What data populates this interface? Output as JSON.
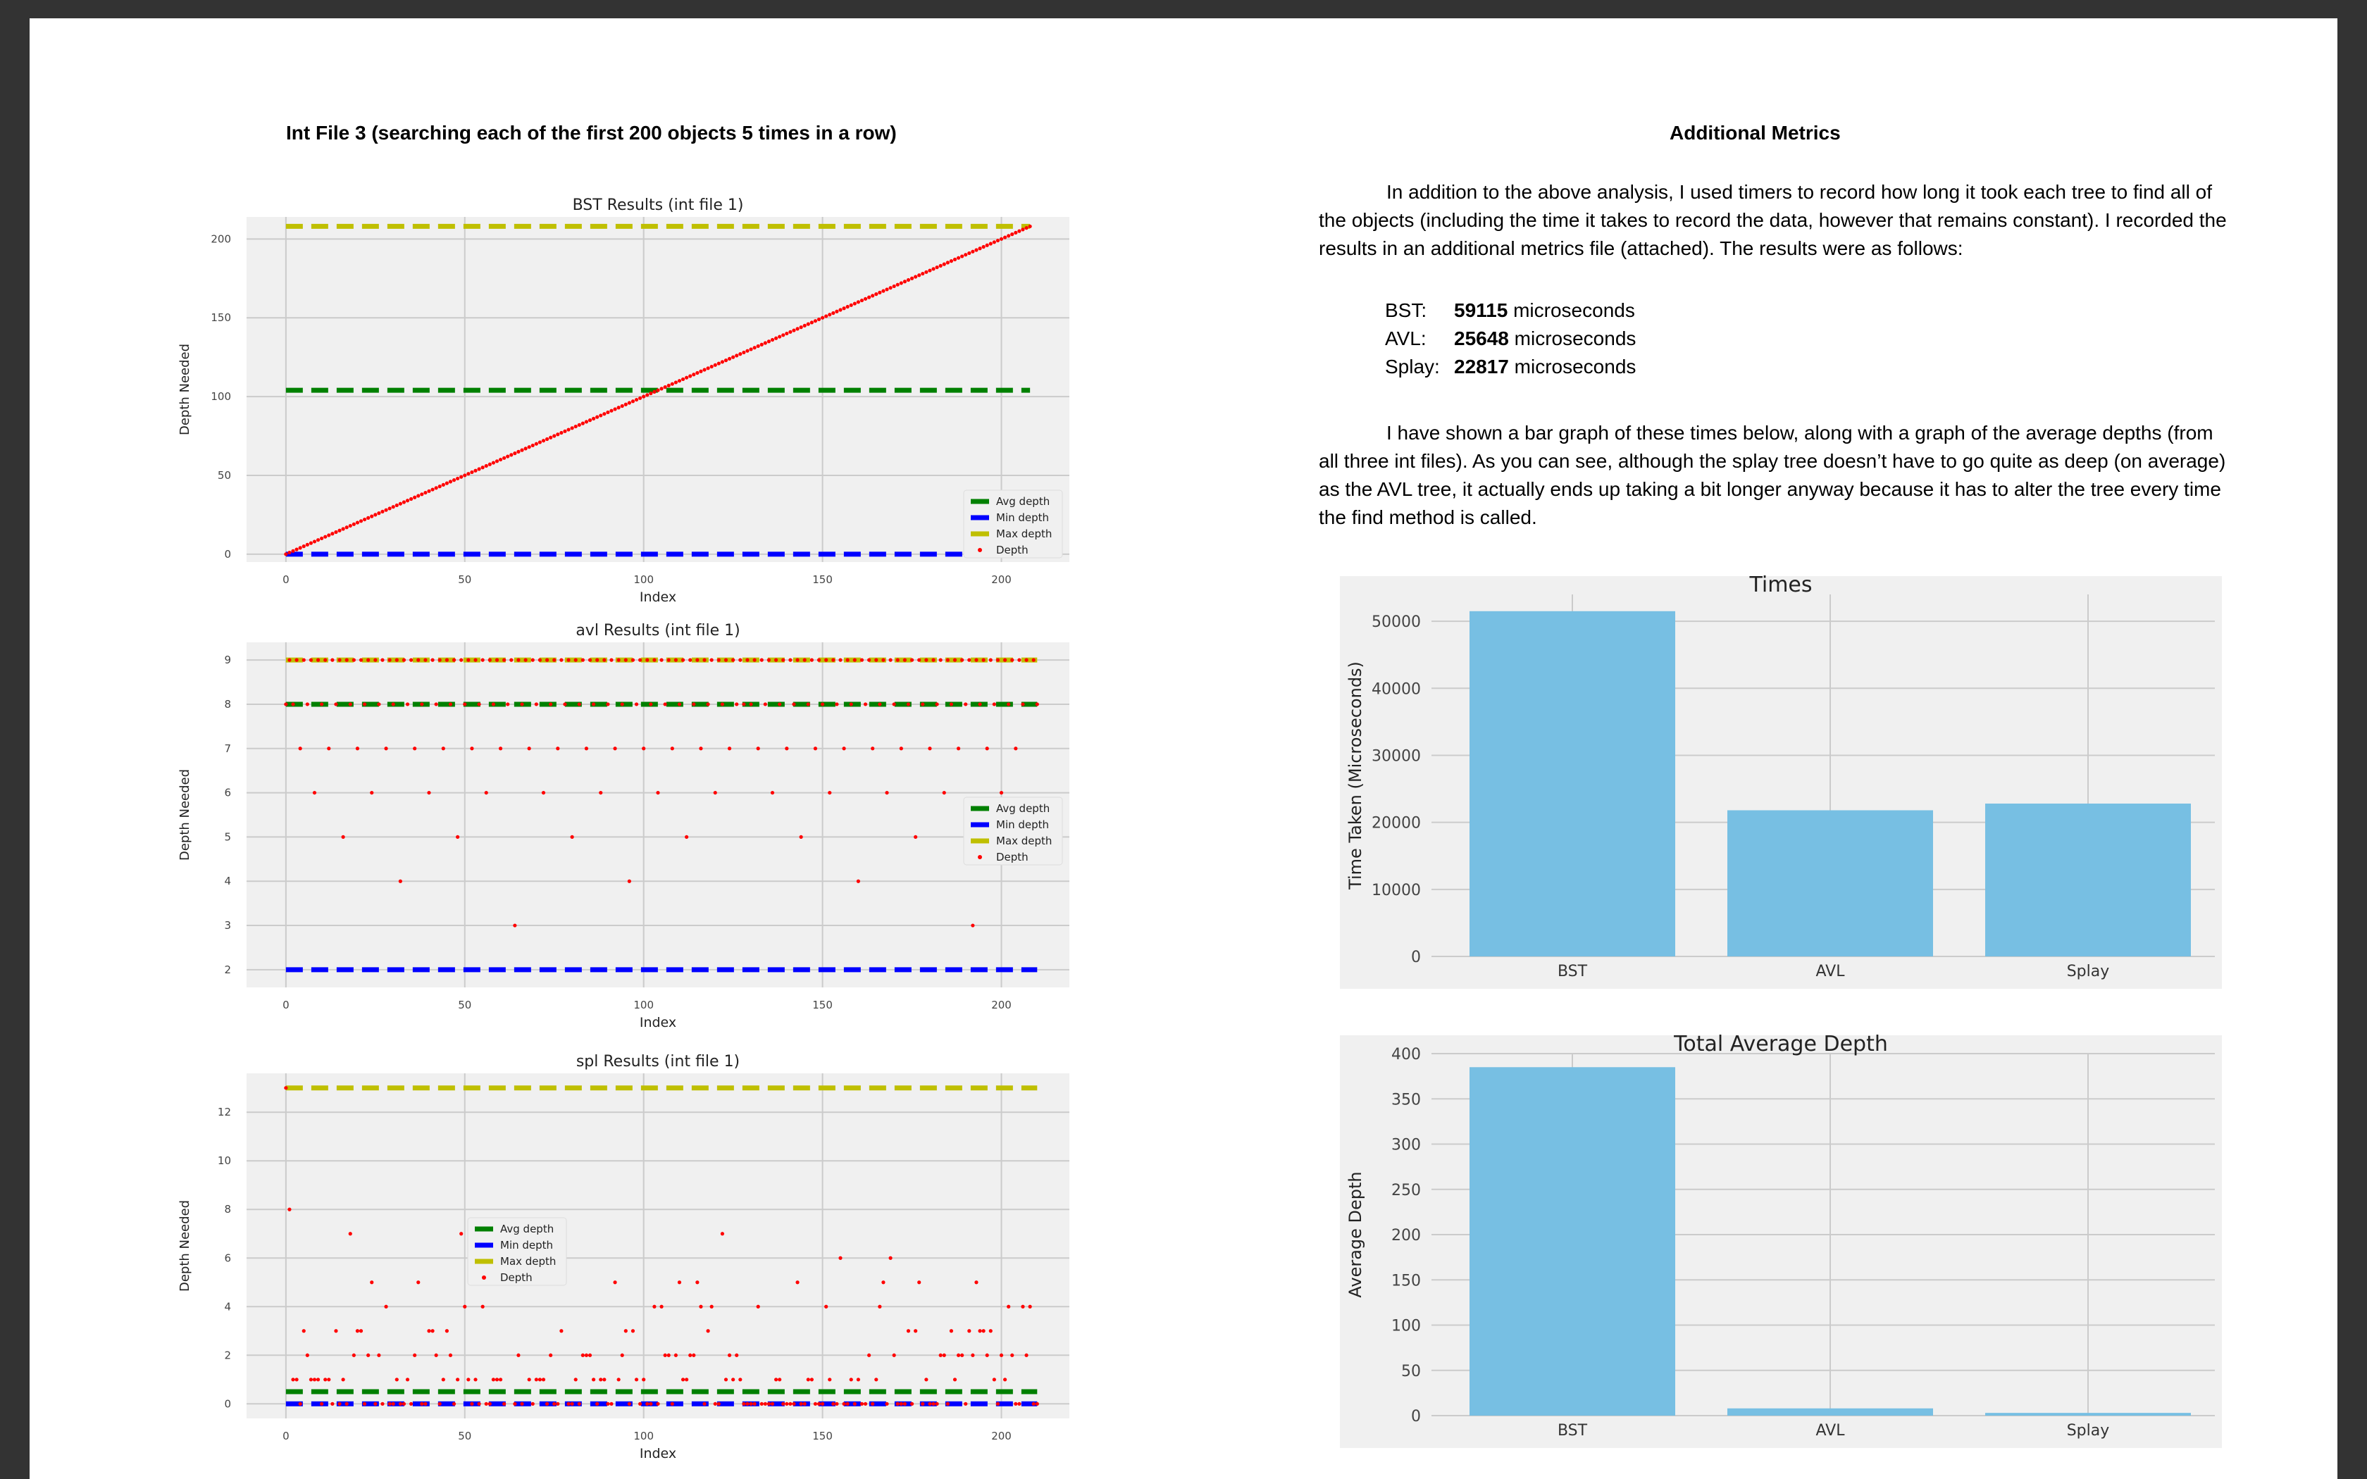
{
  "left_heading": "Int File 3 (searching each of the first 200 objects 5 times in a row)",
  "right_heading": "Additional Metrics",
  "paragraph1": "In addition to the above analysis, I used timers to record how long it took each tree to find all of the objects (including the time it takes to record the data, however that remains constant). I recorded the results in an additional metrics file (attached). The results were as follows:",
  "metrics": [
    {
      "label": "BST:",
      "value": "59115",
      "unit": "microseconds"
    },
    {
      "label": "AVL:",
      "value": "25648",
      "unit": "microseconds"
    },
    {
      "label": "Splay:",
      "value": "22817",
      "unit": "microseconds"
    }
  ],
  "paragraph2": "I have shown a bar graph of these times below, along with a graph of the average depths (from all three int files). As you can see, although the splay tree doesn’t have to go quite as deep (on average) as the AVL tree, it actually ends up taking a bit longer anyway because it has to alter the tree every time the find method is called.",
  "colors": {
    "avg": "#008000",
    "min": "#0000ff",
    "max": "#bfbf00",
    "depth": "#ff0000",
    "bar": "#77bfe3",
    "plot_bg": "#f0f0f0",
    "grid": "#cbcbcb"
  },
  "chart_data": [
    {
      "type": "scatter",
      "title": "BST Results (int file 1)",
      "xlabel": "Index",
      "ylabel": "Depth Needed",
      "xlim": [
        -11,
        219
      ],
      "ylim": [
        -5,
        214
      ],
      "xticks": [
        "0",
        "50",
        "100",
        "150",
        "200"
      ],
      "yticks": [
        "0",
        "50",
        "100",
        "150",
        "200"
      ],
      "legend": [
        "Avg depth",
        "Min depth",
        "Max depth",
        "Depth"
      ],
      "legend_position": "lower right",
      "series": [
        {
          "name": "Avg depth",
          "style": "dashed",
          "x": [
            0,
            208
          ],
          "y": [
            104,
            104
          ]
        },
        {
          "name": "Min depth",
          "style": "dashed",
          "x": [
            0,
            208
          ],
          "y": [
            0,
            0
          ]
        },
        {
          "name": "Max depth",
          "style": "dashed",
          "x": [
            0,
            208
          ],
          "y": [
            208,
            208
          ]
        },
        {
          "name": "Depth",
          "style": "points",
          "pattern": "y = x",
          "x_range": [
            0,
            208
          ]
        }
      ]
    },
    {
      "type": "scatter",
      "title": "avl Results (int file 1)",
      "xlabel": "Index",
      "ylabel": "Depth Needed",
      "xlim": [
        -11,
        219
      ],
      "ylim": [
        1.6,
        9.4
      ],
      "xticks": [
        "0",
        "50",
        "100",
        "150",
        "200"
      ],
      "yticks": [
        "2",
        "3",
        "4",
        "5",
        "6",
        "7",
        "8",
        "9"
      ],
      "legend": [
        "Avg depth",
        "Min depth",
        "Max depth",
        "Depth"
      ],
      "legend_position": "center right",
      "series": [
        {
          "name": "Avg depth",
          "style": "dashed",
          "x": [
            0,
            210
          ],
          "y": [
            8,
            8
          ]
        },
        {
          "name": "Min depth",
          "style": "dashed",
          "x": [
            0,
            210
          ],
          "y": [
            2,
            2
          ]
        },
        {
          "name": "Max depth",
          "style": "dashed",
          "x": [
            0,
            210
          ],
          "y": [
            9,
            9
          ]
        },
        {
          "name": "Depth",
          "style": "points",
          "pattern": "balanced tree depths 3-9",
          "x_range": [
            0,
            210
          ]
        }
      ]
    },
    {
      "type": "scatter",
      "title": "spl Results (int file 1)",
      "xlabel": "Index",
      "ylabel": "Depth Needed",
      "xlim": [
        -11,
        219
      ],
      "ylim": [
        -0.6,
        13.6
      ],
      "xticks": [
        "0",
        "50",
        "100",
        "150",
        "200"
      ],
      "yticks": [
        "0",
        "2",
        "4",
        "6",
        "8",
        "10",
        "12"
      ],
      "legend": [
        "Avg depth",
        "Min depth",
        "Max depth",
        "Depth"
      ],
      "legend_position": "center",
      "series": [
        {
          "name": "Avg depth",
          "style": "dashed",
          "x": [
            0,
            210
          ],
          "y": [
            0.5,
            0.5
          ]
        },
        {
          "name": "Min depth",
          "style": "dashed",
          "x": [
            0,
            210
          ],
          "y": [
            0,
            0
          ]
        },
        {
          "name": "Max depth",
          "style": "dashed",
          "x": [
            0,
            210
          ],
          "y": [
            13,
            13
          ]
        },
        {
          "name": "Depth",
          "style": "points",
          "pattern": "mostly 0-3, occasional spikes to 8 and 13",
          "x_range": [
            0,
            210
          ]
        }
      ]
    },
    {
      "type": "bar",
      "title": "Times",
      "ylabel": "Time Taken (Microseconds)",
      "categories": [
        "BST",
        "AVL",
        "Splay"
      ],
      "values": [
        51500,
        21800,
        22800
      ],
      "ylim": [
        0,
        54000
      ],
      "yticks": [
        "0",
        "10000",
        "20000",
        "30000",
        "40000",
        "50000"
      ]
    },
    {
      "type": "bar",
      "title": "Total Average Depth",
      "ylabel": "Average Depth",
      "categories": [
        "BST",
        "AVL",
        "Splay"
      ],
      "values": [
        385,
        8,
        3
      ],
      "ylim": [
        0,
        400
      ],
      "yticks": [
        "0",
        "50",
        "100",
        "150",
        "200",
        "250",
        "300",
        "350",
        "400"
      ]
    }
  ]
}
